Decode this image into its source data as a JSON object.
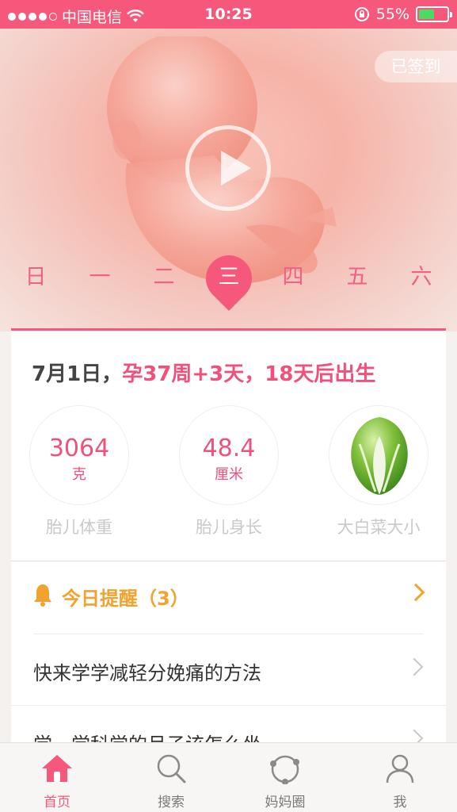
{
  "status_bar": {
    "carrier": "中国电信",
    "time": "10:25",
    "battery": "55%",
    "battery_level": 0.55,
    "signal_bars": 4
  },
  "hero": {
    "signed_in_label": "已签到",
    "weekdays": [
      "日",
      "一",
      "二",
      "三",
      "四",
      "五",
      "六"
    ],
    "selected_weekday_index": 3
  },
  "summary": {
    "date": "7月1日，",
    "pregnancy_status": "孕37周+3天，18天后出生"
  },
  "stats": [
    {
      "value": "3064",
      "unit": "克",
      "label": "胎儿体重"
    },
    {
      "value": "48.4",
      "unit": "厘米",
      "label": "胎儿身长"
    },
    {
      "value": "",
      "unit": "",
      "label": "大白菜大小"
    }
  ],
  "reminder": {
    "title": "今日提醒（3）",
    "items": [
      "快来学学减轻分娩痛的方法",
      "学一学科学的月子该怎么坐"
    ]
  },
  "tabbar": {
    "tabs": [
      "首页",
      "搜索",
      "妈妈圈",
      "我"
    ],
    "active_index": 0
  },
  "colors": {
    "accent": "#f5587b",
    "reminder": "#f0a32e"
  }
}
